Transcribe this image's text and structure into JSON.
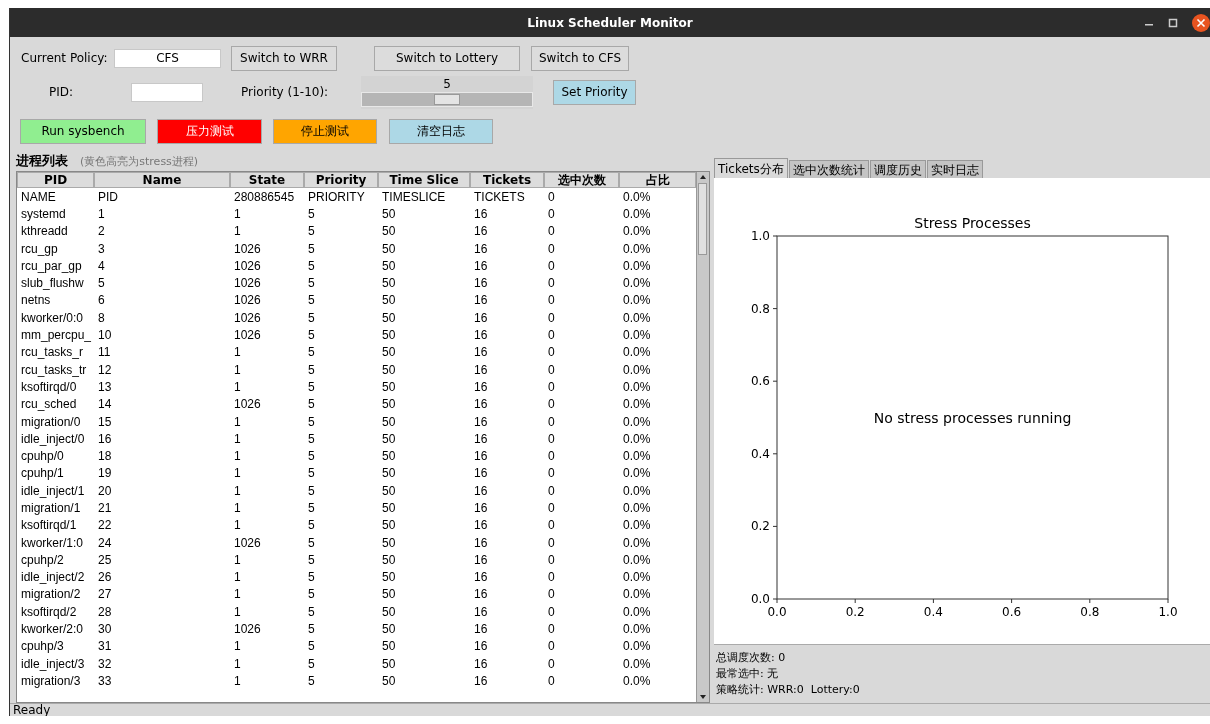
{
  "window": {
    "title": "Linux Scheduler Monitor"
  },
  "controls": {
    "policy_label": "Current Policy:",
    "policy_value": "CFS",
    "policy_buttons": [
      "Switch to WRR",
      "Switch to Lottery",
      "Switch to CFS"
    ],
    "pid_label": "PID:",
    "priority_label": "Priority (1-10):",
    "priority_slider": {
      "reading": "5",
      "level": 0.5
    },
    "set_priority_button": "Set Priority",
    "action_buttons": [
      {
        "label": "Run sysbench",
        "color": "#90ee90"
      },
      {
        "label": "压力测试",
        "color": "#ff0000"
      },
      {
        "label": "停止测试",
        "color": "#ffa500"
      },
      {
        "label": "清空日志",
        "color": "#add8e6"
      }
    ]
  },
  "process_list": {
    "title": "进程列表",
    "hint": "(黄色高亮为stress进程)",
    "columns": [
      "PID",
      "Name",
      "State",
      "Priority",
      "Time Slice",
      "Tickets",
      "选中次数",
      "占比"
    ],
    "rows": [
      [
        "NAME",
        "PID",
        "280886545",
        "PRIORITY",
        "TIMESLICE",
        "TICKETS",
        "0",
        "0.0%"
      ],
      [
        "systemd",
        "1",
        "1",
        "5",
        "50",
        "16",
        "0",
        "0.0%"
      ],
      [
        "kthreadd",
        "2",
        "1",
        "5",
        "50",
        "16",
        "0",
        "0.0%"
      ],
      [
        "rcu_gp",
        "3",
        "1026",
        "5",
        "50",
        "16",
        "0",
        "0.0%"
      ],
      [
        "rcu_par_gp",
        "4",
        "1026",
        "5",
        "50",
        "16",
        "0",
        "0.0%"
      ],
      [
        "slub_flushw",
        "5",
        "1026",
        "5",
        "50",
        "16",
        "0",
        "0.0%"
      ],
      [
        "netns",
        "6",
        "1026",
        "5",
        "50",
        "16",
        "0",
        "0.0%"
      ],
      [
        "kworker/0:0",
        "8",
        "1026",
        "5",
        "50",
        "16",
        "0",
        "0.0%"
      ],
      [
        "mm_percpu_",
        "10",
        "1026",
        "5",
        "50",
        "16",
        "0",
        "0.0%"
      ],
      [
        "rcu_tasks_r",
        "11",
        "1",
        "5",
        "50",
        "16",
        "0",
        "0.0%"
      ],
      [
        "rcu_tasks_tr",
        "12",
        "1",
        "5",
        "50",
        "16",
        "0",
        "0.0%"
      ],
      [
        "ksoftirqd/0",
        "13",
        "1",
        "5",
        "50",
        "16",
        "0",
        "0.0%"
      ],
      [
        "rcu_sched",
        "14",
        "1026",
        "5",
        "50",
        "16",
        "0",
        "0.0%"
      ],
      [
        "migration/0",
        "15",
        "1",
        "5",
        "50",
        "16",
        "0",
        "0.0%"
      ],
      [
        "idle_inject/0",
        "16",
        "1",
        "5",
        "50",
        "16",
        "0",
        "0.0%"
      ],
      [
        "cpuhp/0",
        "18",
        "1",
        "5",
        "50",
        "16",
        "0",
        "0.0%"
      ],
      [
        "cpuhp/1",
        "19",
        "1",
        "5",
        "50",
        "16",
        "0",
        "0.0%"
      ],
      [
        "idle_inject/1",
        "20",
        "1",
        "5",
        "50",
        "16",
        "0",
        "0.0%"
      ],
      [
        "migration/1",
        "21",
        "1",
        "5",
        "50",
        "16",
        "0",
        "0.0%"
      ],
      [
        "ksoftirqd/1",
        "22",
        "1",
        "5",
        "50",
        "16",
        "0",
        "0.0%"
      ],
      [
        "kworker/1:0",
        "24",
        "1026",
        "5",
        "50",
        "16",
        "0",
        "0.0%"
      ],
      [
        "cpuhp/2",
        "25",
        "1",
        "5",
        "50",
        "16",
        "0",
        "0.0%"
      ],
      [
        "idle_inject/2",
        "26",
        "1",
        "5",
        "50",
        "16",
        "0",
        "0.0%"
      ],
      [
        "migration/2",
        "27",
        "1",
        "5",
        "50",
        "16",
        "0",
        "0.0%"
      ],
      [
        "ksoftirqd/2",
        "28",
        "1",
        "5",
        "50",
        "16",
        "0",
        "0.0%"
      ],
      [
        "kworker/2:0",
        "30",
        "1026",
        "5",
        "50",
        "16",
        "0",
        "0.0%"
      ],
      [
        "cpuhp/3",
        "31",
        "1",
        "5",
        "50",
        "16",
        "0",
        "0.0%"
      ],
      [
        "idle_inject/3",
        "32",
        "1",
        "5",
        "50",
        "16",
        "0",
        "0.0%"
      ],
      [
        "migration/3",
        "33",
        "1",
        "5",
        "50",
        "16",
        "0",
        "0.0%"
      ]
    ]
  },
  "chart_panel": {
    "tabs": [
      {
        "label": "Tickets分布",
        "selected": true
      },
      {
        "label": "选中次数统计",
        "selected": false
      },
      {
        "label": "调度历史",
        "selected": false
      },
      {
        "label": "实时日志",
        "selected": false
      }
    ],
    "chart_data": {
      "type": "bar",
      "title": "Stress Processes",
      "xlim": [
        0,
        1
      ],
      "ylim": [
        0,
        1
      ],
      "xticks": [
        {
          "value": 0,
          "label": "0.0"
        },
        {
          "value": 0.2,
          "label": "0.2"
        },
        {
          "value": 0.4,
          "label": "0.4"
        },
        {
          "value": 0.6,
          "label": "0.6"
        },
        {
          "value": 0.8,
          "label": "0.8"
        },
        {
          "value": 1,
          "label": "1.0"
        }
      ],
      "yticks": [
        {
          "value": 0,
          "label": "0.0"
        },
        {
          "value": 0.2,
          "label": "0.2"
        },
        {
          "value": 0.4,
          "label": "0.4"
        },
        {
          "value": 0.6,
          "label": "0.6"
        },
        {
          "value": 0.8,
          "label": "0.8"
        },
        {
          "value": 1,
          "label": "1.0"
        }
      ],
      "annotations": [
        "No stress processes running"
      ]
    },
    "stats": [
      "总调度次数: 0",
      "最常选中: 无",
      "策略统计: WRR:0  Lottery:0"
    ]
  },
  "status_bar": "Ready"
}
